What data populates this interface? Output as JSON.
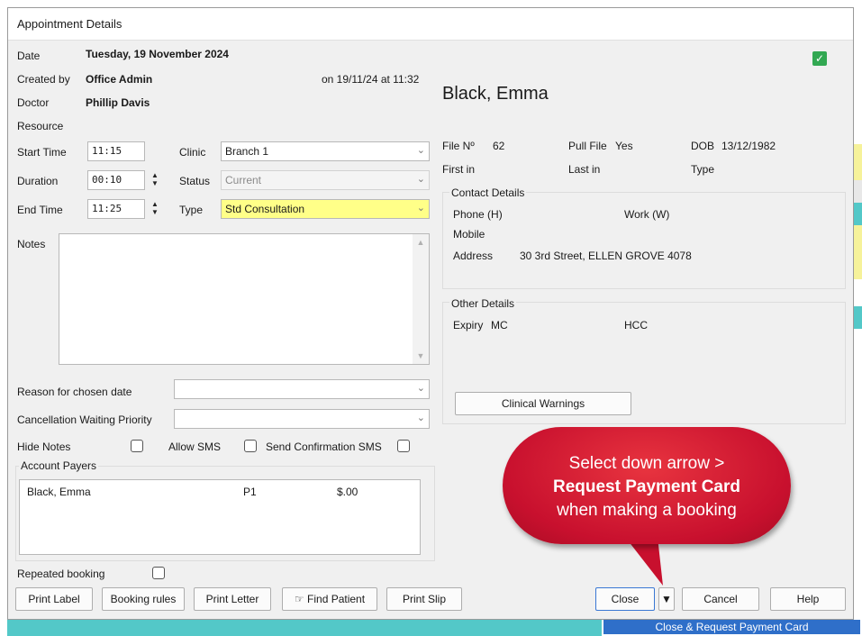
{
  "window": {
    "title": "Appointment Details"
  },
  "appointment": {
    "date_label": "Date",
    "date_value": "Tuesday, 19 November 2024",
    "created_by_label": "Created by",
    "created_by_value": "Office Admin",
    "created_on": "on 19/11/24 at 11:32",
    "doctor_label": "Doctor",
    "doctor_value": "Phillip Davis",
    "resource_label": "Resource",
    "start_time_label": "Start Time",
    "start_time_value": "11:15",
    "duration_label": "Duration",
    "duration_value": "00:10",
    "end_time_label": "End Time",
    "end_time_value": "11:25",
    "clinic_label": "Clinic",
    "clinic_value": "Branch 1",
    "status_label": "Status",
    "status_value": "Current",
    "type_label": "Type",
    "type_value": "Std Consultation",
    "notes_label": "Notes",
    "reason_label": "Reason for chosen date",
    "cancellation_label": "Cancellation Waiting Priority",
    "hide_notes_label": "Hide Notes",
    "allow_sms_label": "Allow SMS",
    "send_confirmation_label": "Send Confirmation SMS",
    "account_payers_label": "Account Payers",
    "payers": [
      {
        "name": "Black, Emma",
        "code": "P1",
        "amount": "$.00"
      }
    ],
    "repeated_booking_label": "Repeated booking"
  },
  "patient": {
    "name": "Black, Emma",
    "file_no_label": "File Nº",
    "file_no_value": "62",
    "pull_file_label": "Pull File",
    "pull_file_value": "Yes",
    "dob_label": "DOB",
    "dob_value": "13/12/1982",
    "first_in_label": "First in",
    "last_in_label": "Last in",
    "type_label": "Type",
    "contact_title": "Contact Details",
    "phone_h_label": "Phone (H)",
    "work_w_label": "Work (W)",
    "mobile_label": "Mobile",
    "address_label": "Address",
    "address_value": "30 3rd Street, ELLEN GROVE 4078",
    "other_title": "Other Details",
    "expiry_label": "Expiry",
    "mc_label": "MC",
    "hcc_label": "HCC",
    "clinical_warnings_label": "Clinical Warnings"
  },
  "buttons": {
    "print_label": "Print Label",
    "booking_rules": "Booking rules",
    "print_letter": "Print Letter",
    "find_patient": "Find Patient",
    "print_slip": "Print Slip",
    "close": "Close",
    "cancel": "Cancel",
    "help": "Help"
  },
  "dropdown_menu": {
    "item": "Close & Request Payment Card"
  },
  "callout": {
    "line1": "Select down arrow >",
    "line2": "Request Payment Card",
    "line3": "when making a booking"
  },
  "colors": {
    "callout_red": "#c8102e",
    "type_highlight": "#ffff88",
    "menu_selected": "#2f6fc9",
    "status_green": "#32a852"
  }
}
